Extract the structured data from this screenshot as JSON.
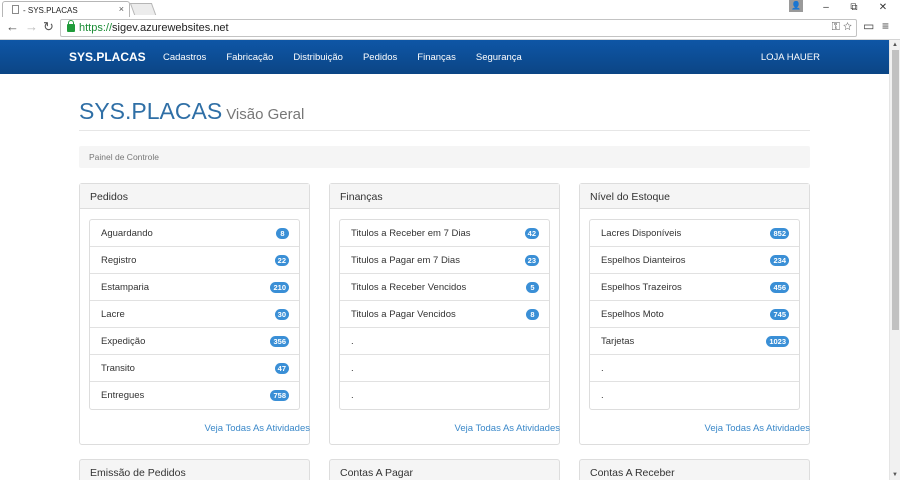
{
  "browser": {
    "tab_title": "- SYS.PLACAS",
    "tab_close": "×",
    "url_scheme": "https://",
    "url_host": "sigev.azurewebsites.net",
    "window_controls": {
      "minimize": "–",
      "restore": "⧉",
      "close": "✕"
    }
  },
  "navbar": {
    "brand": "SYS.PLACAS",
    "menu": [
      "Cadastros",
      "Fabricação",
      "Distribuição",
      "Pedidos",
      "Finanças",
      "Segurança"
    ],
    "store": "LOJA HAUER"
  },
  "header": {
    "title": "SYS.PLACAS",
    "subtitle": "Visão Geral"
  },
  "breadcrumb": "Painel de Controle",
  "panels": [
    {
      "title": "Pedidos",
      "items": [
        {
          "label": "Aguardando",
          "count": "8"
        },
        {
          "label": "Registro",
          "count": "22"
        },
        {
          "label": "Estamparia",
          "count": "210"
        },
        {
          "label": "Lacre",
          "count": "30"
        },
        {
          "label": "Expedição",
          "count": "356"
        },
        {
          "label": "Transito",
          "count": "47"
        },
        {
          "label": "Entregues",
          "count": "758"
        }
      ],
      "link": "Veja Todas As Atividades"
    },
    {
      "title": "Finanças",
      "items": [
        {
          "label": "Titulos a Receber em 7 Dias",
          "count": "42"
        },
        {
          "label": "Titulos a Pagar em 7 Dias",
          "count": "23"
        },
        {
          "label": "Titulos a Receber Vencidos",
          "count": "5"
        },
        {
          "label": "Titulos a Pagar Vencidos",
          "count": "8"
        },
        {
          "label": ".",
          "count": ""
        },
        {
          "label": ".",
          "count": ""
        },
        {
          "label": ".",
          "count": ""
        }
      ],
      "link": "Veja Todas As Atividades"
    },
    {
      "title": "Nível do Estoque",
      "items": [
        {
          "label": "Lacres Disponíveis",
          "count": "852"
        },
        {
          "label": "Espelhos Dianteiros",
          "count": "234"
        },
        {
          "label": "Espelhos Trazeiros",
          "count": "456"
        },
        {
          "label": "Espelhos Moto",
          "count": "745"
        },
        {
          "label": "Tarjetas",
          "count": "1023"
        },
        {
          "label": ".",
          "count": ""
        },
        {
          "label": ".",
          "count": ""
        }
      ],
      "link": "Veja Todas As Atividades"
    }
  ],
  "bottom_panels": [
    "Emissão de Pedidos",
    "Contas A Pagar",
    "Contas A Receber"
  ]
}
